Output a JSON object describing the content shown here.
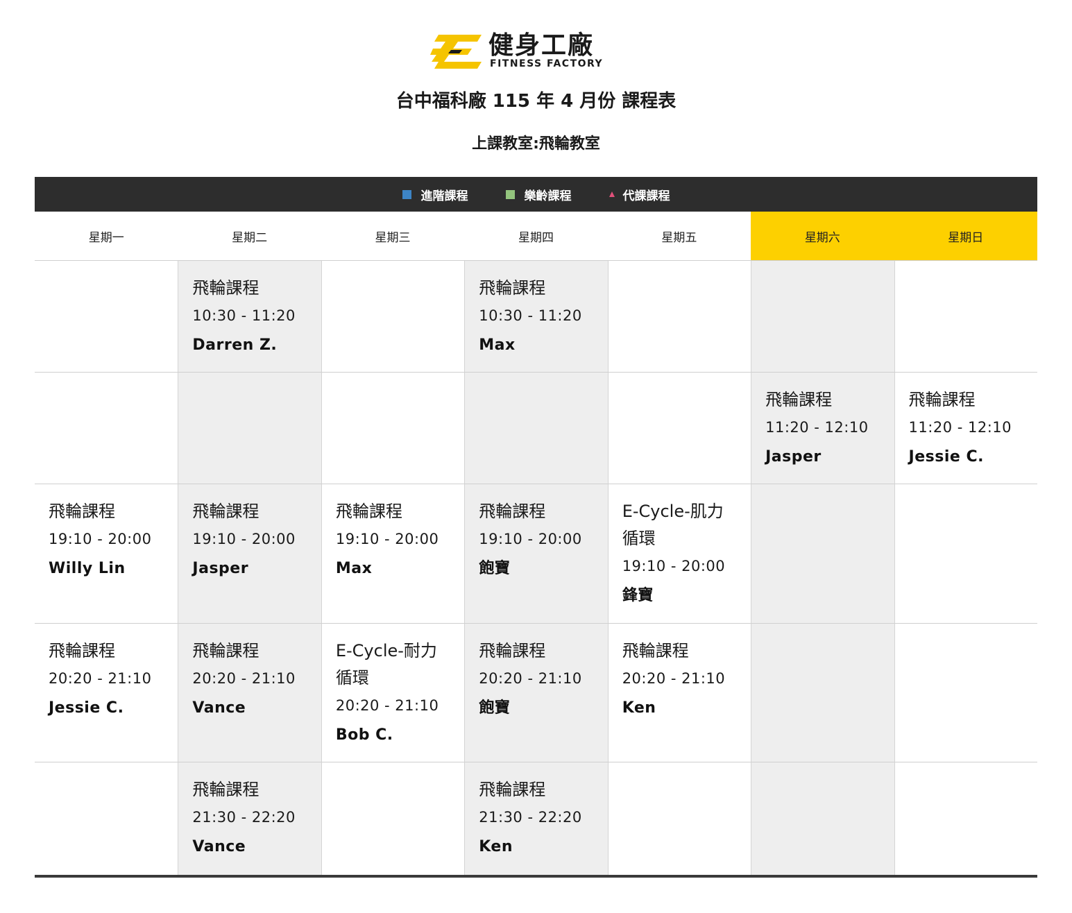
{
  "brand": {
    "name_zh": "健身工廠",
    "name_en": "FITNESS FACTORY",
    "yellow": "#F5C400",
    "dark": "#1A1A1A"
  },
  "title": "台中福科廠 115 年 4 月份 課程表",
  "room": "上課教室:飛輪教室",
  "legend": [
    {
      "label": "進階課程",
      "color": "#3D85C6",
      "shape": "square"
    },
    {
      "label": "樂齡課程",
      "color": "#93C47D",
      "shape": "square"
    },
    {
      "label": "代課課程",
      "color": "#E0507A",
      "shape": "triangle"
    }
  ],
  "days": [
    "星期一",
    "星期二",
    "星期三",
    "星期四",
    "星期五",
    "星期六",
    "星期日"
  ],
  "colors": {
    "weekend_header": "#FDD000",
    "shaded_column": "#EEEEEE",
    "legend_bar": "#2D2D2D"
  },
  "rows": [
    [
      null,
      {
        "name": "飛輪課程",
        "time": "10:30 - 11:20",
        "coach": "Darren Z."
      },
      null,
      {
        "name": "飛輪課程",
        "time": "10:30 - 11:20",
        "coach": "Max"
      },
      null,
      null,
      null
    ],
    [
      null,
      null,
      null,
      null,
      null,
      {
        "name": "飛輪課程",
        "time": "11:20 - 12:10",
        "coach": "Jasper"
      },
      {
        "name": "飛輪課程",
        "time": "11:20 - 12:10",
        "coach": "Jessie C."
      }
    ],
    [
      {
        "name": "飛輪課程",
        "time": "19:10 - 20:00",
        "coach": "Willy Lin"
      },
      {
        "name": "飛輪課程",
        "time": "19:10 - 20:00",
        "coach": "Jasper"
      },
      {
        "name": "飛輪課程",
        "time": "19:10 - 20:00",
        "coach": "Max"
      },
      {
        "name": "飛輪課程",
        "time": "19:10 - 20:00",
        "coach": "飽寶"
      },
      {
        "name": "E-Cycle-肌力循環",
        "time": "19:10 - 20:00",
        "coach": "鋒寶"
      },
      null,
      null
    ],
    [
      {
        "name": "飛輪課程",
        "time": "20:20 - 21:10",
        "coach": "Jessie C."
      },
      {
        "name": "飛輪課程",
        "time": "20:20 - 21:10",
        "coach": "Vance"
      },
      {
        "name": "E-Cycle-耐力循環",
        "time": "20:20 - 21:10",
        "coach": "Bob C."
      },
      {
        "name": "飛輪課程",
        "time": "20:20 - 21:10",
        "coach": "飽寶"
      },
      {
        "name": "飛輪課程",
        "time": "20:20 - 21:10",
        "coach": "Ken"
      },
      null,
      null
    ],
    [
      null,
      {
        "name": "飛輪課程",
        "time": "21:30 - 22:20",
        "coach": "Vance"
      },
      null,
      {
        "name": "飛輪課程",
        "time": "21:30 - 22:20",
        "coach": "Ken"
      },
      null,
      null,
      null
    ]
  ]
}
